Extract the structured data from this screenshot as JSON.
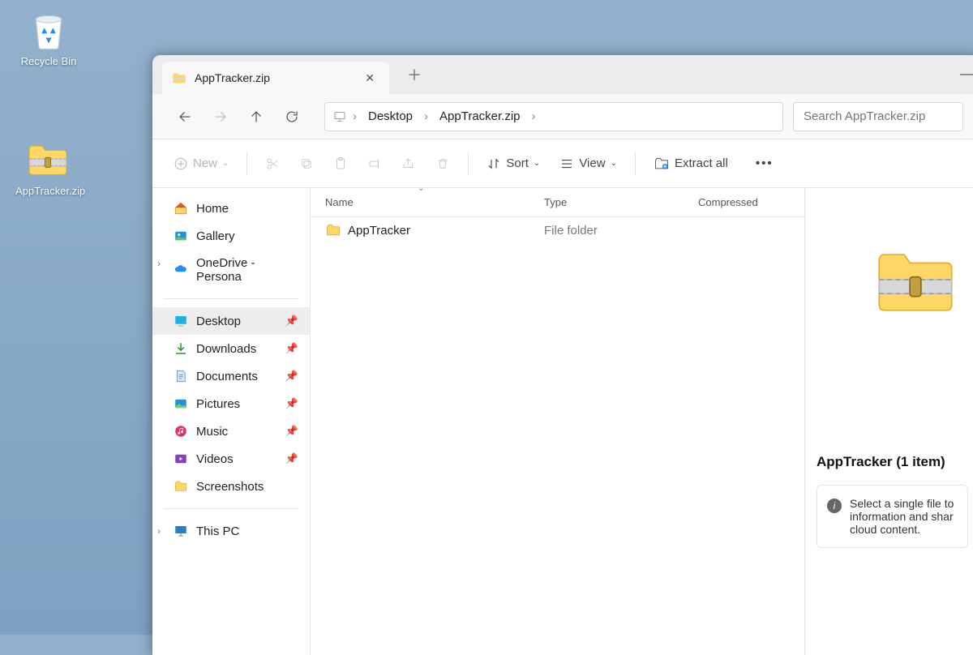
{
  "desktop": {
    "recycle_label": "Recycle Bin",
    "zip_label": "AppTracker.zip"
  },
  "tab": {
    "title": "AppTracker.zip"
  },
  "breadcrumb": {
    "items": [
      "Desktop",
      "AppTracker.zip"
    ]
  },
  "search": {
    "placeholder": "Search AppTracker.zip"
  },
  "toolbar": {
    "new_label": "New",
    "sort_label": "Sort",
    "view_label": "View",
    "extract_label": "Extract all"
  },
  "sidebar": {
    "home": "Home",
    "gallery": "Gallery",
    "onedrive": "OneDrive - Persona",
    "desktop": "Desktop",
    "downloads": "Downloads",
    "documents": "Documents",
    "pictures": "Pictures",
    "music": "Music",
    "videos": "Videos",
    "screenshots": "Screenshots",
    "thispc": "This PC"
  },
  "columns": {
    "name": "Name",
    "type": "Type",
    "compressed": "Compressed"
  },
  "rows": [
    {
      "name": "AppTracker",
      "type": "File folder"
    }
  ],
  "details": {
    "title": "AppTracker (1 item)",
    "info": "Select a single file to information and shar cloud content."
  }
}
